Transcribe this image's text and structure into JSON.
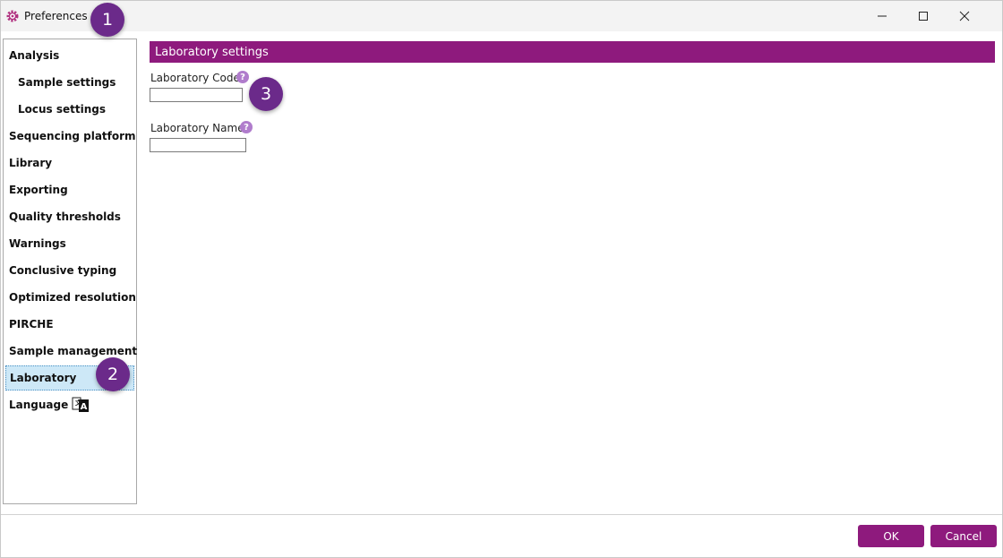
{
  "window": {
    "title": "Preferences",
    "controls": [
      "minimize",
      "maximize",
      "close"
    ]
  },
  "sidebar": {
    "items": [
      {
        "label": "Analysis",
        "sub": false
      },
      {
        "label": "Sample settings",
        "sub": true
      },
      {
        "label": "Locus settings",
        "sub": true
      },
      {
        "label": "Sequencing platform",
        "sub": false
      },
      {
        "label": "Library",
        "sub": false
      },
      {
        "label": "Exporting",
        "sub": false
      },
      {
        "label": "Quality thresholds",
        "sub": false
      },
      {
        "label": "Warnings",
        "sub": false
      },
      {
        "label": "Conclusive typing",
        "sub": false
      },
      {
        "label": "Optimized resolution",
        "sub": false
      },
      {
        "label": "PIRCHE",
        "sub": false
      },
      {
        "label": "Sample management",
        "sub": false
      },
      {
        "label": "Laboratory",
        "sub": false,
        "selected": true
      },
      {
        "label": "Language",
        "sub": false,
        "icon": "translate-icon"
      }
    ]
  },
  "main": {
    "section_title": "Laboratory settings",
    "fields": [
      {
        "label": "Laboratory Code",
        "value": "",
        "help_icon": "?"
      },
      {
        "label": "Laboratory Name",
        "value": "",
        "help_icon": "?"
      }
    ]
  },
  "annotations": [
    "1",
    "2",
    "3"
  ],
  "footer": {
    "ok_label": "OK",
    "cancel_label": "Cancel"
  },
  "colors": {
    "accent": "#8e1a7d",
    "badge": "#6b2a8a",
    "help": "#b07ccc",
    "selection": "#cde8f7"
  }
}
